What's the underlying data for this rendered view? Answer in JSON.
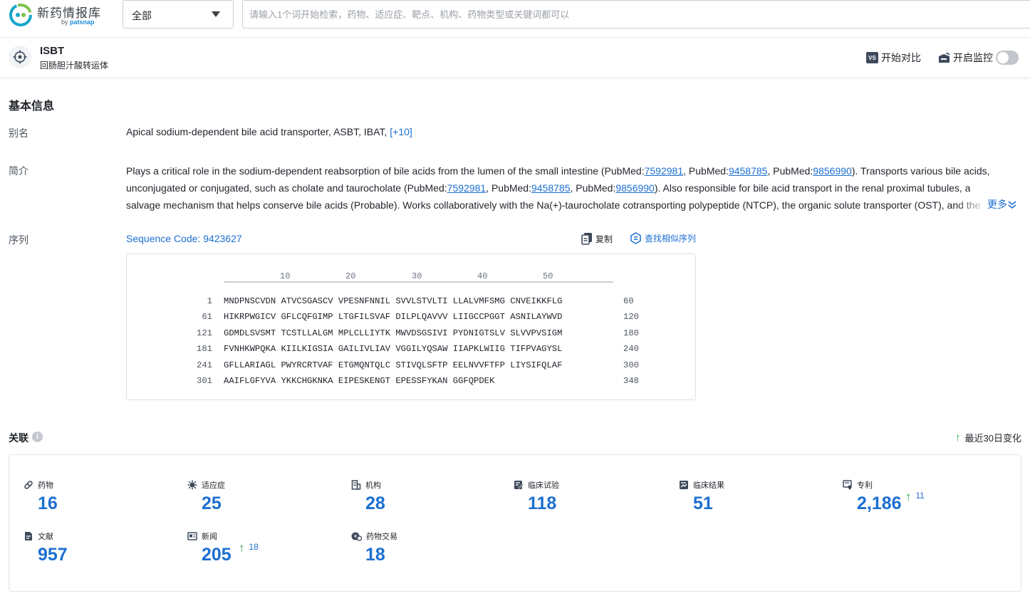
{
  "brand": {
    "title": "新药情报库",
    "sub_by": "by",
    "sub_name": "patsnap"
  },
  "search": {
    "scope": "全部",
    "placeholder": "请输入1个词开始检索，药物、适应症、靶点、机构、药物类型或关键词都可以"
  },
  "target": {
    "name": "ISBT",
    "cn_name": "回肠胆汁酸转运体",
    "compare_badge": "VS",
    "compare_label": "开始对比",
    "monitor_label": "开启监控",
    "monitor_on": false
  },
  "basic_info": {
    "title": "基本信息",
    "alias_label": "别名",
    "alias_text": "Apical sodium-dependent bile acid transporter,  ASBT,  IBAT,",
    "alias_more": "[+10]",
    "intro_label": "简介",
    "intro_segments": [
      "Plays a critical role in the sodium-dependent reabsorption of bile acids from the lumen of the small intestine (PubMed:",
      "7592981",
      ", PubMed:",
      "9458785",
      ", PubMed:",
      "9856990",
      "). Transports various bile acids, unconjugated or conjugated, such as cholate and taurocholate (PubMed:",
      "7592981",
      ", PubMed:",
      "9458785",
      ", PubMed:",
      "9856990",
      "). Also responsible for bile acid transport in the renal proximal tubules, a salvage mechanism that helps conserve bile acids (Probable). Works collaboratively with the Na(+)-taurocholate cotransporting polypeptide (NTCP), the organic solute transporter (OST), and the bile salt export pump (BSEP), to ensure efficacious biological recycling of bile acids during enterohepatic circulation."
    ],
    "more_label": "更多",
    "sequence_label": "序列",
    "sequence_code": "Sequence Code: 9423627",
    "copy_label": "复制",
    "similar_label": "查找相似序列",
    "ruler_ticks": [
      "10",
      "20",
      "30",
      "40",
      "50"
    ],
    "sequence_rows": [
      {
        "start": "1",
        "seq": "MNDPNSCVDN ATVCSGASCV VPESNFNNIL SVVLSTVLTI LLALVMFSMG CNVEIKKFLG",
        "end": "60"
      },
      {
        "start": "61",
        "seq": "HIKRPWGICV GFLCQFGIMP LTGFILSVAF DILPLQAVVV LIIGCCPGGT ASNILAYWVD",
        "end": "120"
      },
      {
        "start": "121",
        "seq": "GDMDLSVSMT TCSTLLALGM MPLCLLIYTK MWVDSGSIVI PYDNIGTSLV SLVVPVSIGM",
        "end": "180"
      },
      {
        "start": "181",
        "seq": "FVNHKWPQKA KIILKIGSIA GAILIVLIAV VGGILYQSAW IIAPKLWIIG TIFPVAGYSL",
        "end": "240"
      },
      {
        "start": "241",
        "seq": "GFLLARIAGL PWYRCRTVAF ETGMQNTQLC STIVQLSFTP EELNVVFTFP LIYSIFQLAF",
        "end": "300"
      },
      {
        "start": "301",
        "seq": "AAIFLGFYVA YKKCHGKNKA EIPESKENGT EPESSFYKAN GGFQPDEK",
        "end": "348"
      }
    ]
  },
  "associations": {
    "title": "关联",
    "info_glyph": "i",
    "legend_label": "最近30日变化",
    "stats": [
      {
        "key": "drug",
        "label": "药物",
        "value": "16",
        "delta": null
      },
      {
        "key": "indication",
        "label": "适应症",
        "value": "25",
        "delta": null
      },
      {
        "key": "organization",
        "label": "机构",
        "value": "28",
        "delta": null
      },
      {
        "key": "clinical-trial",
        "label": "临床试验",
        "value": "118",
        "delta": null
      },
      {
        "key": "clinical-result",
        "label": "临床结果",
        "value": "51",
        "delta": null
      },
      {
        "key": "patent",
        "label": "专利",
        "value": "2,186",
        "delta": "11"
      },
      {
        "key": "literature",
        "label": "文献",
        "value": "957",
        "delta": null
      },
      {
        "key": "news",
        "label": "新闻",
        "value": "205",
        "delta": "18"
      },
      {
        "key": "deal",
        "label": "药物交易",
        "value": "18",
        "delta": null
      }
    ]
  },
  "colors": {
    "link": "#1c6fd1",
    "up": "#22a447",
    "text": "#1f2329"
  }
}
